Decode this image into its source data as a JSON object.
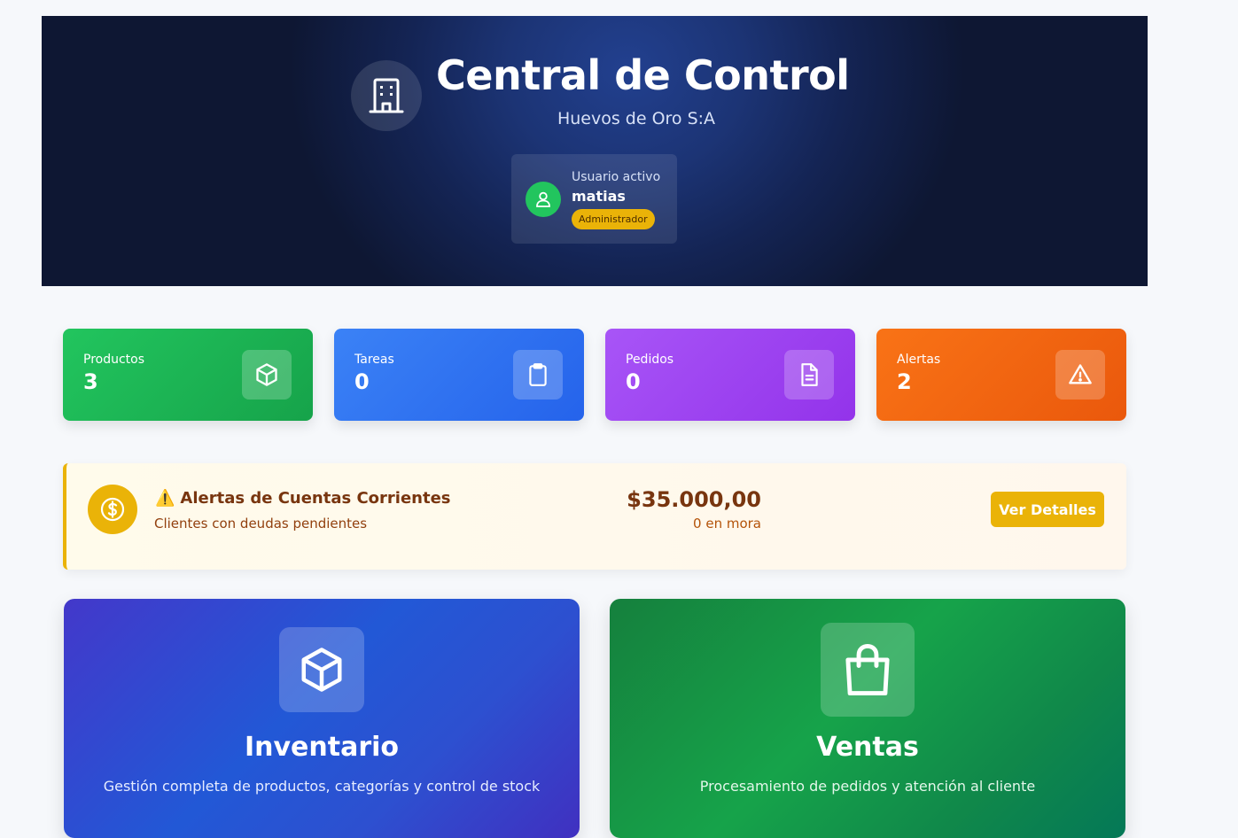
{
  "header": {
    "title": "Central de Control",
    "subtitle": "Huevos de Oro S:A",
    "logo_icon": "building-icon",
    "user": {
      "caption": "Usuario activo",
      "name": "matias",
      "role": "Administrador",
      "avatar_icon": "user-icon"
    }
  },
  "stats": [
    {
      "label": "Productos",
      "value": "3",
      "icon": "box-icon",
      "color": "#22c55e"
    },
    {
      "label": "Tareas",
      "value": "0",
      "icon": "clipboard-icon",
      "color": "#3b82f6"
    },
    {
      "label": "Pedidos",
      "value": "0",
      "icon": "document-icon",
      "color": "#a855f7"
    },
    {
      "label": "Alertas",
      "value": "2",
      "icon": "warning-icon",
      "color": "#f97316"
    }
  ],
  "alert": {
    "emoji": "⚠️",
    "title": "Alertas de Cuentas Corrientes",
    "subtitle": "Clientes con deudas pendientes",
    "amount": "$35.000,00",
    "count": "0 en mora",
    "button": "Ver Detalles",
    "icon": "dollar-coin-icon",
    "accent": "#eab308"
  },
  "modules": [
    {
      "title": "Inventario",
      "description": "Gestión completa de productos, categorías y control de stock",
      "icon": "box-icon"
    },
    {
      "title": "Ventas",
      "description": "Procesamiento de pedidos y atención al cliente",
      "icon": "shopping-bag-icon"
    }
  ]
}
